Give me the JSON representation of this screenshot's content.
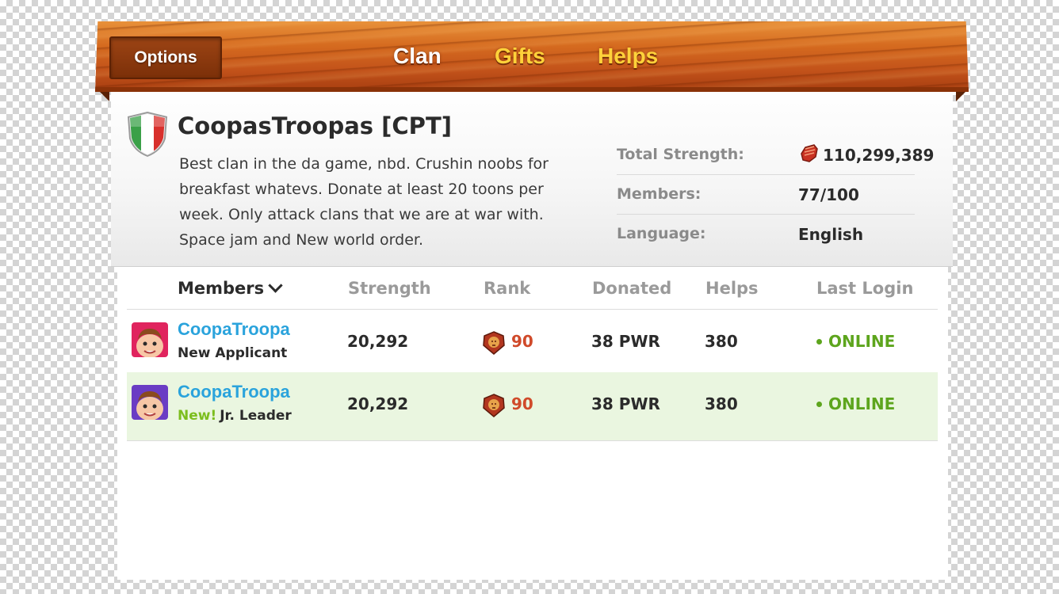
{
  "header": {
    "options_label": "Options",
    "tabs": [
      {
        "label": "Clan",
        "active": true
      },
      {
        "label": "Gifts",
        "active": false
      },
      {
        "label": "Helps",
        "active": false
      }
    ]
  },
  "clan": {
    "name": "CoopasTroopas [CPT]",
    "flag_icon": "italy-flag-shield-icon",
    "description": "Best clan in the da game, nbd. Crushin noobs for breakfast whatevs. Donate at least 20 toons per week. Only attack clans that we are at war with. Space jam and New world order.",
    "stats": {
      "total_strength_label": "Total Strength:",
      "total_strength_value": "110,299,389",
      "members_label": "Members:",
      "members_value": "77/100",
      "language_label": "Language:",
      "language_value": "English"
    }
  },
  "table": {
    "columns": {
      "members": "Members",
      "strength": "Strength",
      "rank": "Rank",
      "donated": "Donated",
      "helps": "Helps",
      "last_login": "Last Login"
    },
    "rows": [
      {
        "name": "CoopaTroopa",
        "role_new": "",
        "role": "New Applicant",
        "strength": "20,292",
        "rank": "90",
        "donated": "38 PWR",
        "helps": "380",
        "last_login": "ONLINE",
        "highlight": false
      },
      {
        "name": "CoopaTroopa",
        "role_new": "New!",
        "role": "Jr. Leader",
        "strength": "20,292",
        "rank": "90",
        "donated": "38 PWR",
        "helps": "380",
        "last_login": "ONLINE",
        "highlight": true
      }
    ]
  },
  "colors": {
    "member_name": "#2aa3dc",
    "online": "#5da51d",
    "rank": "#d04a2a",
    "tab_active": "#ffffff",
    "tab_inactive": "#ffd23a",
    "row_highlight": "#eaf6e0"
  }
}
